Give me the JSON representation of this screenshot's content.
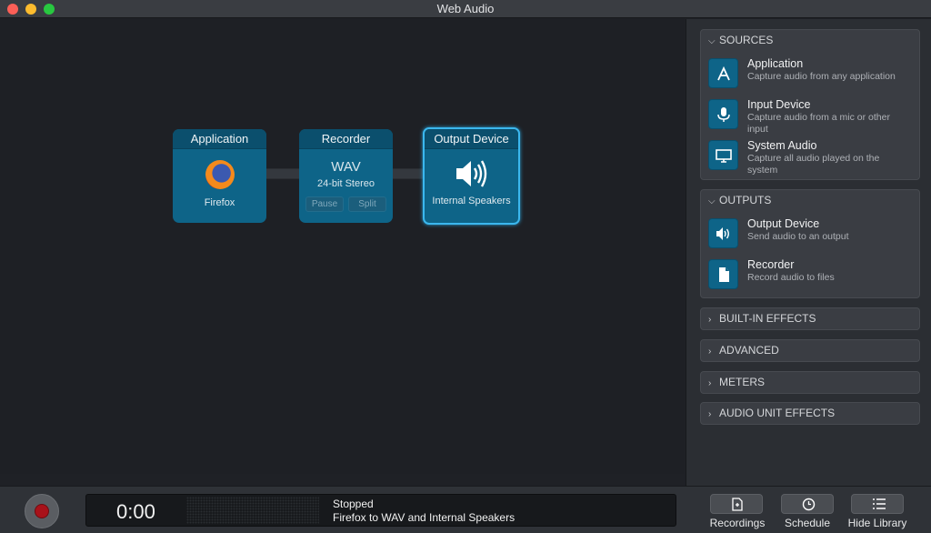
{
  "window": {
    "title": "Web Audio"
  },
  "graph": {
    "nodes": [
      {
        "header": "Application",
        "subtitle": "Firefox",
        "icon": "firefox-icon"
      },
      {
        "header": "Recorder",
        "format": "WAV",
        "details": "24-bit Stereo",
        "buttons": [
          "Pause",
          "Split"
        ]
      },
      {
        "header": "Output Device",
        "subtitle": "Internal Speakers",
        "icon": "speaker-icon",
        "selected": true
      }
    ]
  },
  "library": {
    "sources": {
      "title": "SOURCES",
      "items": [
        {
          "name": "Application",
          "desc": "Capture audio from any application",
          "icon": "app-store-icon"
        },
        {
          "name": "Input Device",
          "desc": "Capture audio from a mic or other input",
          "icon": "microphone-icon"
        },
        {
          "name": "System Audio",
          "desc": "Capture all audio played on the system",
          "icon": "monitor-icon"
        }
      ]
    },
    "outputs": {
      "title": "OUTPUTS",
      "items": [
        {
          "name": "Output Device",
          "desc": "Send audio to an output",
          "icon": "speaker-icon"
        },
        {
          "name": "Recorder",
          "desc": "Record audio to files",
          "icon": "document-icon"
        }
      ]
    },
    "collapsed": [
      "BUILT-IN EFFECTS",
      "ADVANCED",
      "METERS",
      "AUDIO UNIT EFFECTS"
    ]
  },
  "transport": {
    "time": "0:00",
    "status": "Stopped",
    "status_detail": "Firefox to WAV and Internal Speakers",
    "buttons": [
      {
        "label": "Recordings",
        "icon": "recordings-icon"
      },
      {
        "label": "Schedule",
        "icon": "clock-icon"
      },
      {
        "label": "Hide Library",
        "icon": "list-icon"
      }
    ]
  },
  "colors": {
    "node": "#0e6488",
    "node_header": "#0b4f6d",
    "selected_border": "#3bb7ee",
    "record": "#a8121a"
  }
}
